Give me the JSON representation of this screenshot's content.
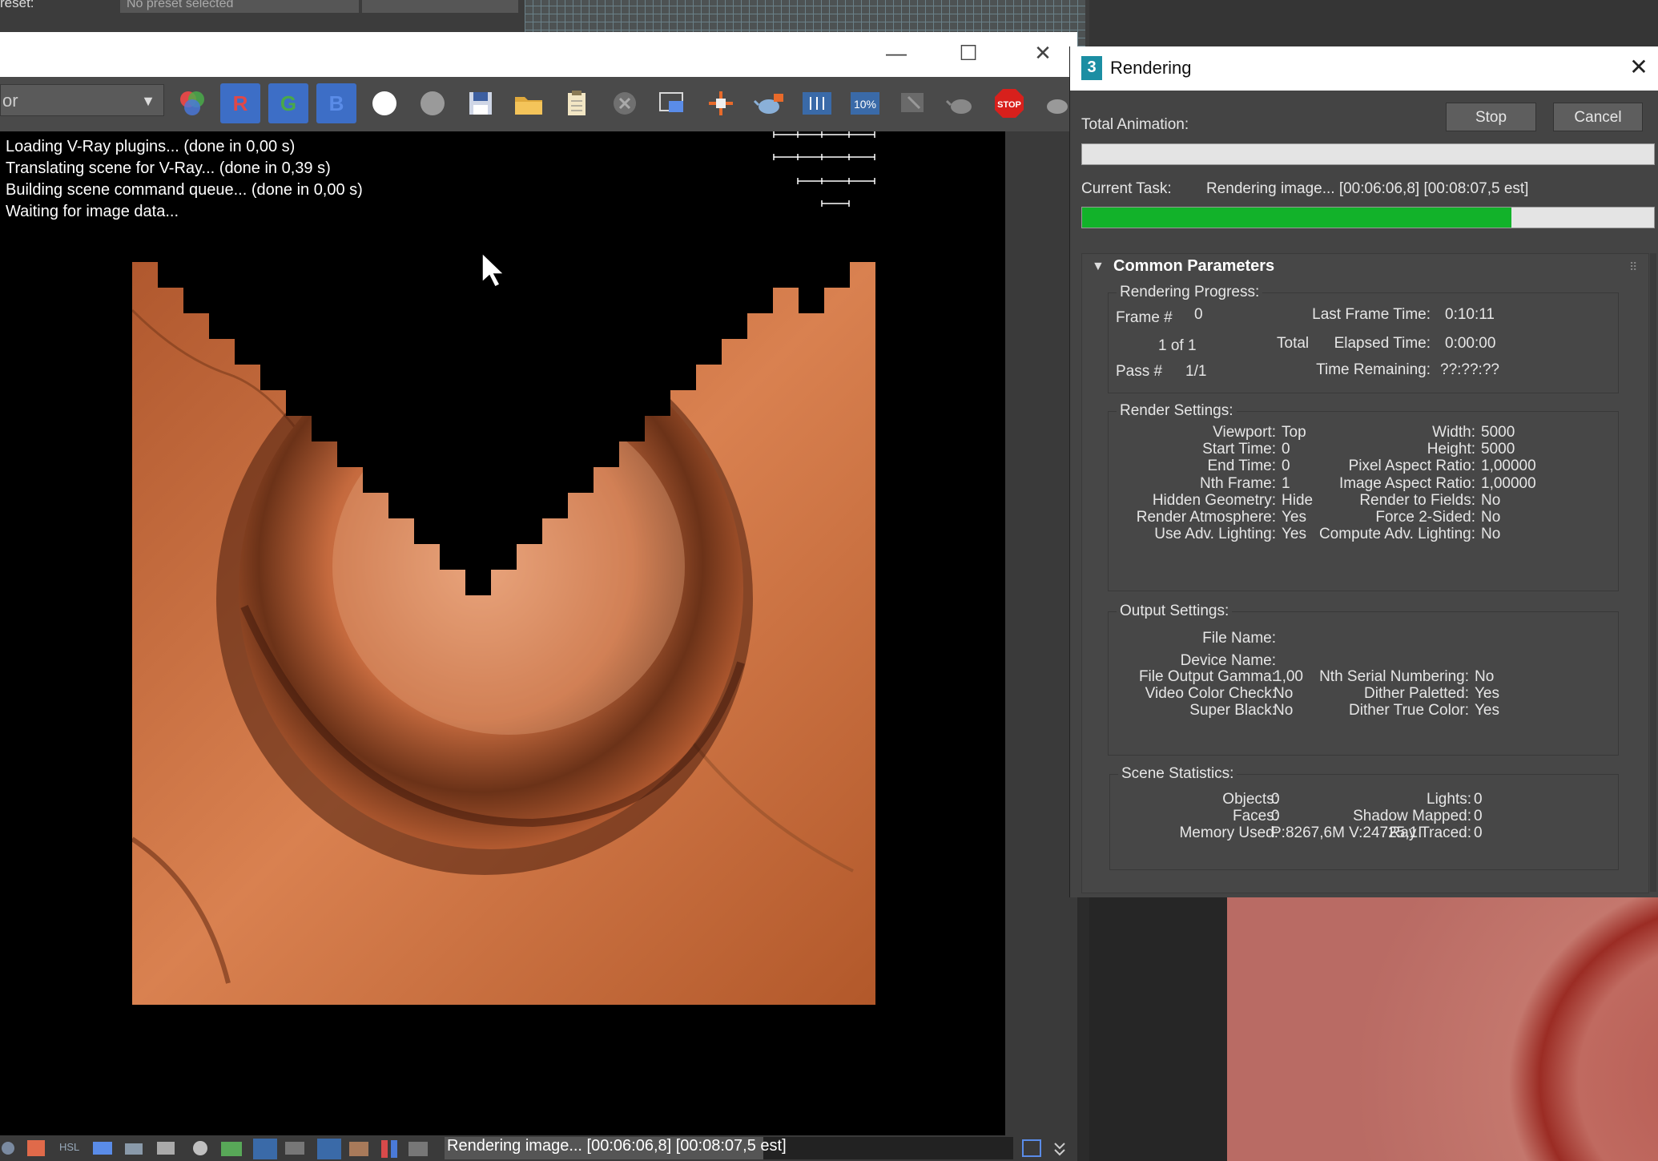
{
  "background_app": {
    "preset_label": "reset:",
    "preset_value": "No preset selected"
  },
  "frame_buffer": {
    "window_controls": {
      "minimize": "—",
      "maximize": "☐",
      "close": "✕"
    },
    "channel_select": "or",
    "toolbar": {
      "r": "R",
      "g": "G",
      "b": "B",
      "stop": "STOP",
      "zoom": "10%"
    },
    "log": [
      "Loading V-Ray plugins... (done in 0,00 s)",
      "Translating scene for V-Ray... (done in 0,39 s)",
      "Building scene command queue... (done in 0,00 s)",
      "Waiting for image data..."
    ],
    "status": {
      "text": "Rendering image... [00:06:06,8] [00:08:07,5 est]",
      "progress": 0.56
    }
  },
  "rendering_dialog": {
    "title": "Rendering",
    "close": "✕",
    "total_animation_label": "Total Animation:",
    "total_animation_progress": 0.0,
    "stop_label": "Stop",
    "cancel_label": "Cancel",
    "current_task_label": "Current Task:",
    "current_task_value": "Rendering image... [00:06:06,8] [00:08:07,5 est]",
    "current_task_progress": 0.75,
    "common_parameters": "Common Parameters",
    "progress_group": {
      "title": "Rendering Progress:",
      "frame_label": "Frame #",
      "frame_value": "0",
      "frame_count": "1 of 1",
      "total_label": "Total",
      "pass_label": "Pass #",
      "pass_value": "1/1",
      "last_frame_label": "Last Frame Time:",
      "last_frame_value": "0:10:11",
      "elapsed_label": "Elapsed Time:",
      "elapsed_value": "0:00:00",
      "remaining_label": "Time Remaining:",
      "remaining_value": "??:??:??"
    },
    "render_settings": {
      "title": "Render Settings:",
      "left": [
        {
          "label": "Viewport:",
          "value": "Top"
        },
        {
          "label": "Start Time:",
          "value": "0"
        },
        {
          "label": "End Time:",
          "value": "0"
        },
        {
          "label": "Nth Frame:",
          "value": "1"
        },
        {
          "label": "Hidden Geometry:",
          "value": "Hide"
        },
        {
          "label": "Render Atmosphere:",
          "value": "Yes"
        },
        {
          "label": "Use Adv. Lighting:",
          "value": "Yes"
        }
      ],
      "right": [
        {
          "label": "Width:",
          "value": "5000"
        },
        {
          "label": "Height:",
          "value": "5000"
        },
        {
          "label": "Pixel Aspect Ratio:",
          "value": "1,00000"
        },
        {
          "label": "Image Aspect Ratio:",
          "value": "1,00000"
        },
        {
          "label": "Render to Fields:",
          "value": "No"
        },
        {
          "label": "Force 2-Sided:",
          "value": "No"
        },
        {
          "label": "Compute Adv. Lighting:",
          "value": "No"
        }
      ]
    },
    "output_settings": {
      "title": "Output Settings:",
      "file_name_label": "File Name:",
      "device_name_label": "Device Name:",
      "left": [
        {
          "label": "File Output Gamma:",
          "value": "1,00"
        },
        {
          "label": "Video Color Check:",
          "value": "No"
        },
        {
          "label": "Super Black:",
          "value": "No"
        }
      ],
      "right": [
        {
          "label": "Nth Serial Numbering:",
          "value": "No"
        },
        {
          "label": "Dither Paletted:",
          "value": "Yes"
        },
        {
          "label": "Dither True Color:",
          "value": "Yes"
        }
      ]
    },
    "scene_statistics": {
      "title": "Scene Statistics:",
      "left": [
        {
          "label": "Objects:",
          "value": "0"
        },
        {
          "label": "Faces:",
          "value": "0"
        },
        {
          "label": "Memory Used:",
          "value": "P:8267,6M V:24725,1I"
        }
      ],
      "right": [
        {
          "label": "Lights:",
          "value": "0"
        },
        {
          "label": "Shadow Mapped:",
          "value": "0"
        },
        {
          "label": "Ray Traced:",
          "value": "0"
        }
      ]
    }
  }
}
